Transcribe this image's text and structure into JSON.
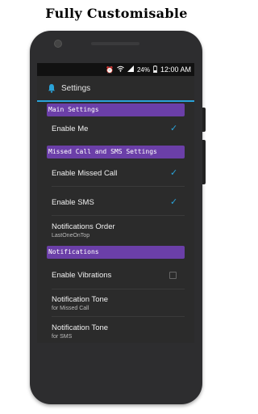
{
  "headline": "Fully Customisable",
  "status": {
    "battery": "24%",
    "time": "12:00 AM"
  },
  "app": {
    "title": "Settings"
  },
  "sections": {
    "main": "Main Settings",
    "missed": "Missed Call and SMS Settings",
    "notifications": "Notifications"
  },
  "rows": {
    "enable_me": {
      "label": "Enable Me",
      "checked": true
    },
    "enable_missed_call": {
      "label": "Enable Missed Call",
      "checked": true
    },
    "enable_sms": {
      "label": "Enable SMS",
      "checked": true
    },
    "notifications_order": {
      "label": "Notifications Order",
      "summary": "LastOneOnTop"
    },
    "enable_vibrations": {
      "label": "Enable Vibrations",
      "checked": false
    },
    "tone_missed": {
      "label": "Notification Tone",
      "summary": "for Missed Call"
    },
    "tone_sms": {
      "label": "Notification Tone",
      "summary": "for SMS"
    }
  },
  "colors": {
    "accent": "#2aa3d9",
    "section": "#6b3fa8"
  }
}
